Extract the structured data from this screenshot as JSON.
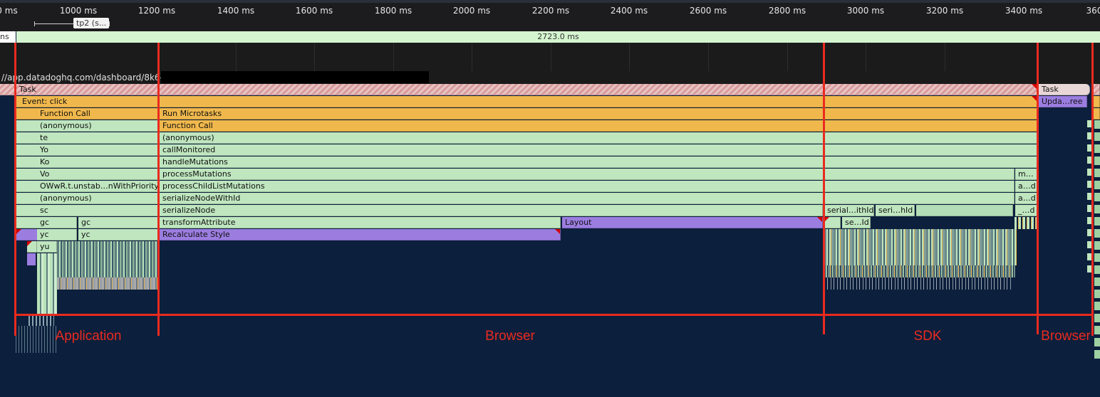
{
  "ruler": {
    "ticks": [
      "0 ms",
      "1000 ms",
      "1200 ms",
      "1400 ms",
      "1600 ms",
      "1800 ms",
      "2000 ms",
      "2200 ms",
      "2400 ms",
      "2600 ms",
      "2800 ms",
      "3000 ms",
      "3200 ms",
      "3400 ms",
      "360"
    ],
    "marker_label": "tp2 (s..."
  },
  "duration": {
    "left_label": "ns",
    "value": "2723.0 ms"
  },
  "url": "//app.datadoghq.com/dashboard/8k6-e",
  "tracks": {
    "task_main": "Task",
    "task_right": "Task",
    "event_click": "Event: click",
    "update_right": "Upda…ree",
    "app_stack": [
      "Function Call",
      "(anonymous)",
      "te",
      "Yo",
      "Ko",
      "Vo",
      "OWwR.t.unstab…nWithPriority",
      "(anonymous)",
      "sc",
      "gc",
      "yc",
      "yu"
    ],
    "app_stack_sub": [
      "gc",
      "yc"
    ],
    "browser_stack": [
      "Run Microtasks",
      "Function Call",
      "(anonymous)",
      "callMonitored",
      "handleMutations",
      "processMutations",
      "processChildListMutations",
      "serializeNodeWithId",
      "serializeNode",
      "transformAttribute",
      "Recalculate Style"
    ],
    "layout": "Layout",
    "sdk_stack": [
      "serial…ithId",
      "seri…hId",
      "se…Id"
    ],
    "right_small": [
      "m…",
      "a…d",
      "a…d",
      "_…d"
    ]
  },
  "annotations": {
    "application": "Application",
    "browser": "Browser",
    "sdk": "SDK",
    "browser2": "Browser"
  },
  "colors": {
    "annotation_red": "#ea2a1f",
    "js_green": "#bfe6bf",
    "event_orange": "#f0b84c",
    "render_purple": "#9b7de0",
    "background": "#0c1f3c"
  }
}
